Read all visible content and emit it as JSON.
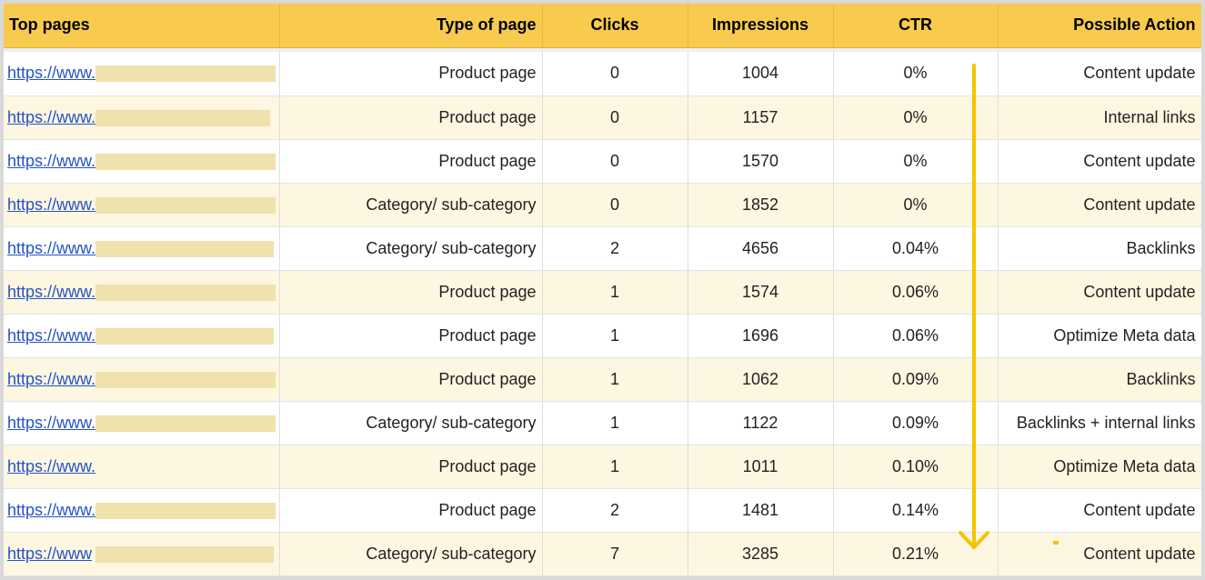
{
  "table": {
    "headers": [
      "Top pages",
      "Type of page",
      "Clicks",
      "Impressions",
      "CTR",
      "Possible Action"
    ],
    "rows": [
      {
        "url": "https://www.",
        "type": "Product page",
        "clicks": "0",
        "impressions": "1004",
        "ctr": "0%",
        "action": "Content update"
      },
      {
        "url": "https://www.",
        "type": "Product page",
        "clicks": "0",
        "impressions": "1157",
        "ctr": "0%",
        "action": "Internal links"
      },
      {
        "url": "https://www.",
        "type": "Product page",
        "clicks": "0",
        "impressions": "1570",
        "ctr": "0%",
        "action": "Content update"
      },
      {
        "url": "https://www.",
        "type": "Category/ sub-category",
        "clicks": "0",
        "impressions": "1852",
        "ctr": "0%",
        "action": "Content update"
      },
      {
        "url": "https://www.",
        "type": "Category/ sub-category",
        "clicks": "2",
        "impressions": "4656",
        "ctr": "0.04%",
        "action": "Backlinks"
      },
      {
        "url": "https://www.",
        "type": "Product page",
        "clicks": "1",
        "impressions": "1574",
        "ctr": "0.06%",
        "action": "Content update"
      },
      {
        "url": "https://www.",
        "type": "Product page",
        "clicks": "1",
        "impressions": "1696",
        "ctr": "0.06%",
        "action": "Optimize Meta data"
      },
      {
        "url": "https://www.",
        "type": "Product page",
        "clicks": "1",
        "impressions": "1062",
        "ctr": "0.09%",
        "action": "Backlinks"
      },
      {
        "url": "https://www.",
        "type": "Category/ sub-category",
        "clicks": "1",
        "impressions": "1122",
        "ctr": "0.09%",
        "action": "Backlinks + internal links"
      },
      {
        "url": "https://www.",
        "type": "Product page",
        "clicks": "1",
        "impressions": "1011",
        "ctr": "0.10%",
        "action": "Optimize Meta data"
      },
      {
        "url": "https://www.",
        "type": "Product page",
        "clicks": "2",
        "impressions": "1481",
        "ctr": "0.14%",
        "action": "Content update"
      },
      {
        "url": "https://www",
        "type": "Category/ sub-category",
        "clicks": "7",
        "impressions": "3285",
        "ctr": "0.21%",
        "action": "Content update"
      }
    ]
  },
  "colors": {
    "header_bg": "#f8cb4f",
    "row_alt_bg": "#fdf6e1",
    "link": "#2552c8",
    "arrow": "#f5c400",
    "redaction": "#efe2ad"
  },
  "annotation": {
    "arrow_icon": "down-arrow-icon"
  }
}
